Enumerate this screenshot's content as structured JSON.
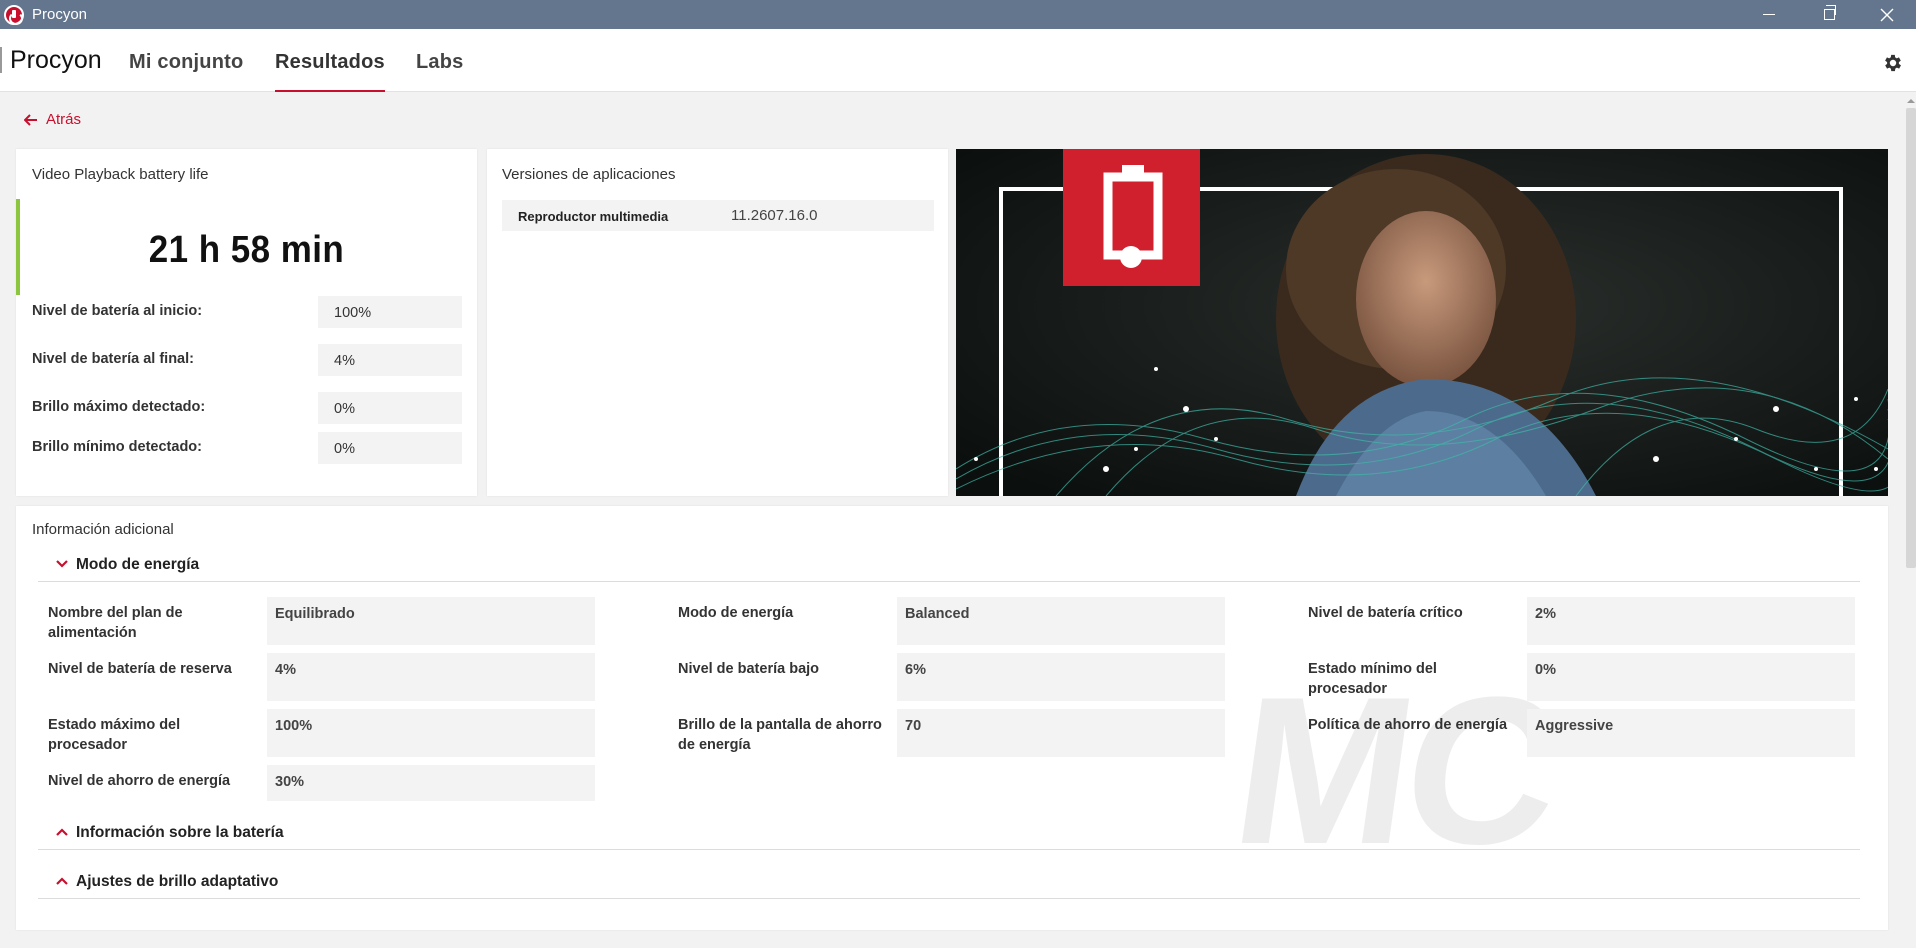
{
  "window": {
    "title": "Procyon"
  },
  "nav": {
    "brand": "Procyon",
    "tabs": [
      {
        "label": "Mi conjunto"
      },
      {
        "label": "Resultados"
      },
      {
        "label": "Labs"
      }
    ]
  },
  "back": {
    "label": "Atrás"
  },
  "result": {
    "title": "Video Playback battery life",
    "score": "21 h 58 min",
    "rows": [
      {
        "label": "Nivel de batería al inicio:",
        "value": "100%"
      },
      {
        "label": "Nivel de batería al final:",
        "value": "4%"
      },
      {
        "label": "Brillo máximo detectado:",
        "value": "0%"
      },
      {
        "label": "Brillo mínimo detectado:",
        "value": "0%"
      }
    ],
    "accent": "#8cc63f"
  },
  "versions": {
    "title": "Versiones de aplicaciones",
    "rows": [
      {
        "label": "Reproductor multimedia",
        "value": "11.2607.16.0"
      }
    ]
  },
  "additional": {
    "title": "Información adicional",
    "sections": [
      {
        "title": "Modo de energía",
        "expanded": true,
        "items": [
          {
            "label": "Nombre del plan de alimentación",
            "value": "Equilibrado"
          },
          {
            "label": "Modo de energía",
            "value": "Balanced"
          },
          {
            "label": "Nivel de batería crítico",
            "value": "2%"
          },
          {
            "label": "Nivel de batería de reserva",
            "value": "4%"
          },
          {
            "label": "Nivel de batería bajo",
            "value": "6%"
          },
          {
            "label": "Estado mínimo del procesador",
            "value": "0%"
          },
          {
            "label": "Estado máximo del procesador",
            "value": "100%"
          },
          {
            "label": "Brillo de la pantalla de ahorro de energía",
            "value": "70"
          },
          {
            "label": "Política de ahorro de energía",
            "value": "Aggressive"
          },
          {
            "label": "Nivel de ahorro de energía",
            "value": "30%"
          }
        ]
      },
      {
        "title": "Información sobre la batería",
        "expanded": false
      },
      {
        "title": "Ajustes de brillo adaptativo",
        "expanded": false
      }
    ]
  },
  "watermark": "MC",
  "colors": {
    "accent": "#c8102e",
    "titlebar": "#64758e"
  }
}
